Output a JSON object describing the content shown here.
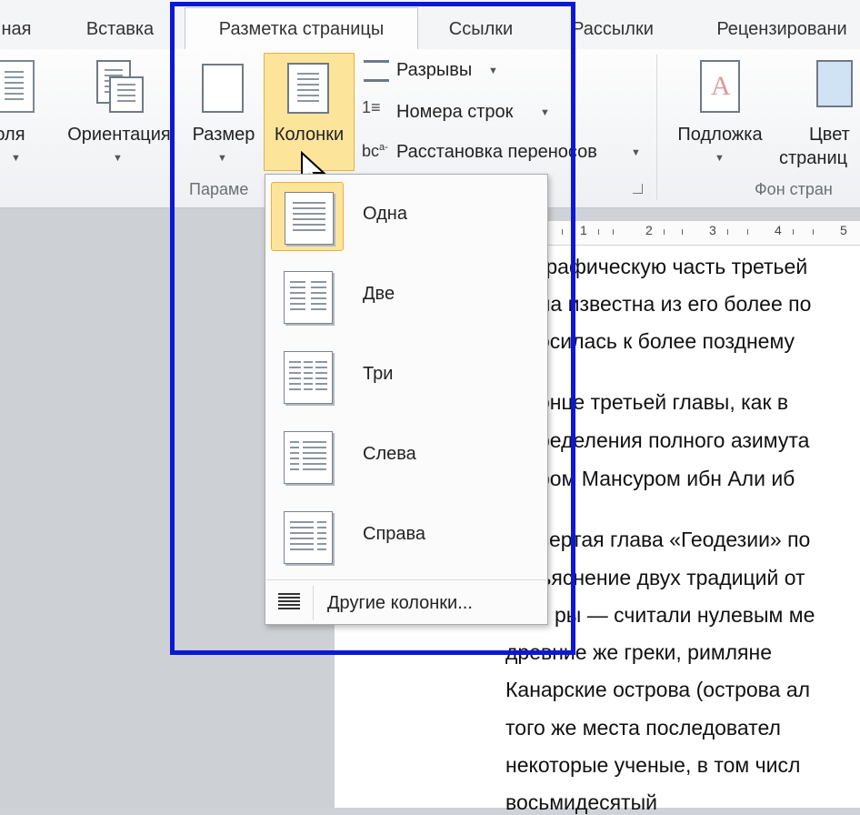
{
  "tabs": [
    {
      "label": "ная"
    },
    {
      "label": "Вставка"
    },
    {
      "label": "Разметка страницы"
    },
    {
      "label": "Ссылки"
    },
    {
      "label": "Рассылки"
    },
    {
      "label": "Рецензировани"
    }
  ],
  "ribbon": {
    "margins_label": "Поля",
    "orientation_label": "Ориентация",
    "size_label": "Размер",
    "columns_label": "Колонки",
    "breaks_label": "Разрывы",
    "line_numbers_label": "Номера строк",
    "hyphenation_label": "Расстановка переносов",
    "page_setup_group": "Параме",
    "watermark_label": "Подложка",
    "page_color_label_1": "Цвет",
    "page_color_label_2": "страниц",
    "page_background_group": "Фон стран"
  },
  "columns_menu": {
    "items": [
      {
        "label": "Одна"
      },
      {
        "label": "Две"
      },
      {
        "label": "Три"
      },
      {
        "label": "Слева"
      },
      {
        "label": "Справа"
      }
    ],
    "more_label": "Другие колонки..."
  },
  "ruler": {
    "numbers": [
      "1",
      "2",
      "3",
      "4",
      "5"
    ]
  },
  "document": {
    "lines": [
      "графическую часть третьей",
      "ла известна из его более по",
      "осилась к более позднему",
      "онце третьей главы, как в",
      "ределения полного азимута",
      "ром Мансуром ибн Али иб",
      "вертая глава «Геодезии» по",
      "ъяснение двух традиций от",
      "ры — считали нулевым ме",
      "древние же греки, римляне",
      "Канарские острова (острова ал",
      "того же места последовател",
      "некоторые ученые, в том числ",
      "восьмидесятый"
    ]
  },
  "colors": {
    "highlight_frame": "#0a18d8",
    "selected_fill": "#fde49b"
  }
}
